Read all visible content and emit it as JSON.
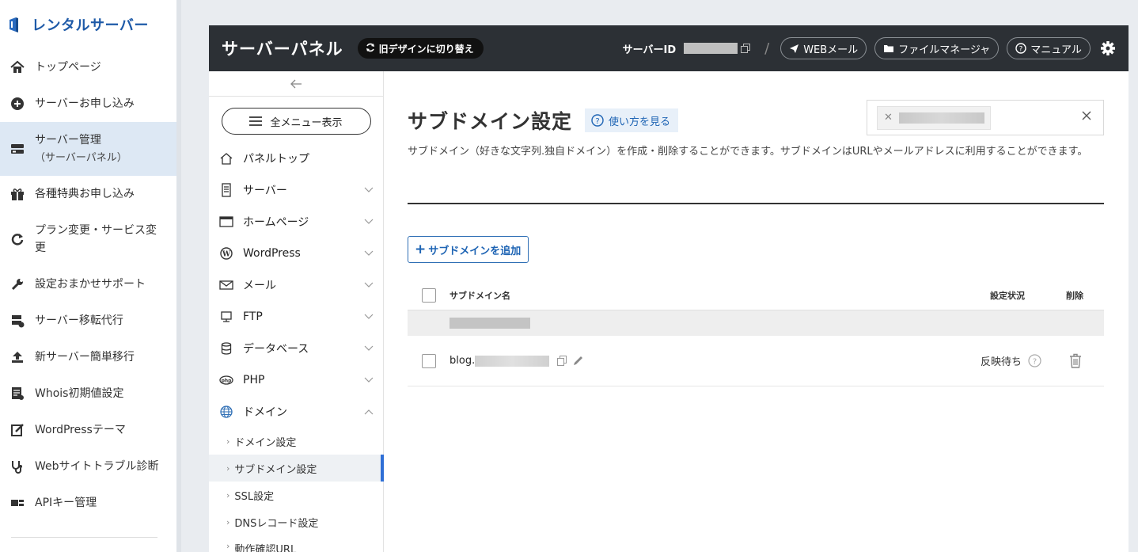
{
  "sidebar": {
    "brand": "レンタルサーバー",
    "items": [
      {
        "icon": "home-icon",
        "label": "トップページ"
      },
      {
        "icon": "plus-circle-icon",
        "label": "サーバーお申し込み"
      },
      {
        "icon": "server-icon",
        "label": "サーバー管理",
        "sub": "（サーバーパネル）"
      },
      {
        "icon": "gift-icon",
        "label": "各種特典お申し込み"
      },
      {
        "icon": "refresh-icon",
        "label": "プラン変更・サービス変更"
      },
      {
        "icon": "wrench-icon",
        "label": "設定おまかせサポート"
      },
      {
        "icon": "server-transfer-icon",
        "label": "サーバー移転代行"
      },
      {
        "icon": "upload-icon",
        "label": "新サーバー簡単移行"
      },
      {
        "icon": "whois-icon",
        "label": "Whois初期値設定"
      },
      {
        "icon": "edit-icon",
        "label": "WordPressテーマ"
      },
      {
        "icon": "stethoscope-icon",
        "label": "Webサイトトラブル診断"
      },
      {
        "icon": "key-icon",
        "label": "APIキー管理"
      }
    ]
  },
  "topbar": {
    "title": "サーバーパネル",
    "switch_label": "旧デザインに切り替え",
    "server_id_label": "サーバーID",
    "slash": "/",
    "webmail": "WEBメール",
    "file_manager": "ファイルマネージャ",
    "manual": "マニュアル"
  },
  "menu": {
    "all_menu": "全メニュー表示",
    "items": [
      {
        "icon": "home-outline-icon",
        "label": "パネルトップ"
      },
      {
        "icon": "server-outline-icon",
        "label": "サーバー"
      },
      {
        "icon": "browser-icon",
        "label": "ホームページ"
      },
      {
        "icon": "wordpress-icon",
        "label": "WordPress"
      },
      {
        "icon": "mail-icon",
        "label": "メール"
      },
      {
        "icon": "monitor-icon",
        "label": "FTP"
      },
      {
        "icon": "database-icon",
        "label": "データベース"
      },
      {
        "icon": "php-icon",
        "label": "PHP"
      },
      {
        "icon": "globe-icon",
        "label": "ドメイン"
      }
    ],
    "sub_items": [
      "ドメイン設定",
      "サブドメイン設定",
      "SSL設定",
      "DNSレコード設定",
      "動作確認URL"
    ]
  },
  "content": {
    "title": "サブドメイン設定",
    "howto": "使い方を見る",
    "description": "サブドメイン（好きな文字列.独自ドメイン）を作成・削除することができます。サブドメインはURLやメールアドレスに利用することができます。",
    "add_button": "サブドメインを追加",
    "table": {
      "col_name": "サブドメイン名",
      "col_status": "設定状況",
      "col_delete": "削除",
      "rows": [
        {
          "name_prefix": "blog.",
          "status": "反映待ち"
        }
      ]
    }
  },
  "colors": {
    "topbar_bg": "#2c3035",
    "accent_blue": "#1e64b4",
    "brand_blue": "#1e5aa8",
    "active_bg": "#dde8f4"
  }
}
